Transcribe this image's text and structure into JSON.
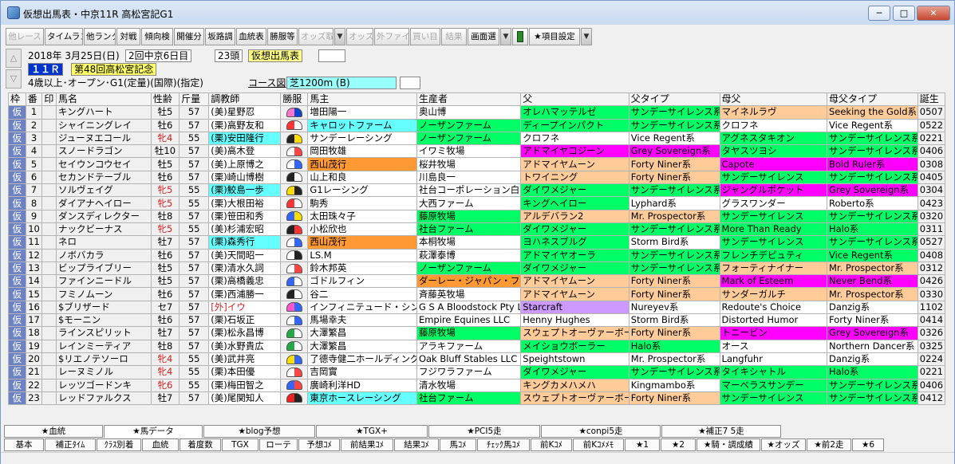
{
  "window": {
    "title": "仮想出馬表・中京11R 高松宮記G1",
    "minimize": "─",
    "maximize": "□",
    "close": "✕",
    "icon": "app-icon"
  },
  "toolbar": [
    {
      "label": "他レース",
      "enabled": false,
      "w": 48
    },
    {
      "label": "タイムランク",
      "enabled": true,
      "w": 48
    },
    {
      "label": "他ランク",
      "enabled": true,
      "w": 40
    },
    {
      "label": "対戦",
      "enabled": true,
      "w": 30
    },
    {
      "label": "傾向検",
      "enabled": true,
      "w": 40
    },
    {
      "label": "開催分",
      "enabled": true,
      "w": 38
    },
    {
      "label": "坂路調",
      "enabled": true,
      "w": 38
    },
    {
      "label": "血統表",
      "enabled": true,
      "w": 38
    },
    {
      "label": "勝服等",
      "enabled": true,
      "w": 38
    },
    {
      "label": "オッズ取",
      "enabled": false,
      "w": 44,
      "dd": true
    },
    {
      "label": "オッズ",
      "enabled": false,
      "w": 34
    },
    {
      "label": "外ファイル",
      "enabled": false,
      "w": 44
    },
    {
      "label": "買い目",
      "enabled": false,
      "w": 38
    },
    {
      "label": "結果",
      "enabled": false,
      "w": 32
    },
    {
      "label": "画面選",
      "enabled": true,
      "w": 40,
      "dd": true
    },
    {
      "label": "",
      "enabled": true,
      "w": 20,
      "icon": "pin-icon"
    },
    {
      "label": "★項目設定",
      "enabled": true,
      "w": 64,
      "dd": true
    }
  ],
  "race": {
    "date": "2018年 3月25日(日)",
    "meeting": "2回中京6日目",
    "entries": "23頭",
    "mode": "仮想出馬表",
    "number": "１１Ｒ",
    "name": "第48回高松宮記念",
    "conditions": "4歳以上･オープン･G1(定量)(国際)(指定)",
    "course_label": "コース図",
    "course": "芝1200m (B)"
  },
  "columns": [
    "枠",
    "番",
    "印",
    "馬名",
    "性齢",
    "斤量",
    "調教師",
    "勝服",
    "馬主",
    "生産者",
    "父",
    "父タイプ",
    "母父",
    "母父タイプ",
    "誕生"
  ],
  "colors": {
    "green": "#00ff66",
    "cyan": "#66ffff",
    "tan": "#ffcc99",
    "magenta": "#ff00ff",
    "orange": "#ff9933",
    "purple": "#cc99ff",
    "plain": "#ffffff"
  },
  "rows": [
    {
      "waku": "仮",
      "ban": "1",
      "name": "キングハート",
      "sex": "牡5",
      "kin": "57",
      "trainer": "(美)星野忍",
      "owner": "増田陽一",
      "breeder": "奥山博",
      "sire": "オレハマッテルゼ",
      "sire_type": "サンデーサイレンス系",
      "dam_sire": "マイネルラヴ",
      "dam_sire_type": "Seeking the Gold系",
      "birth": "0507",
      "cl": {
        "trainer": "plain",
        "owner": "plain",
        "breeder": "plain",
        "sire": "green",
        "sire_type": "green",
        "dam_sire": "tan",
        "dam_sire_type": "tan"
      },
      "silk": [
        "#ff77cc",
        "#1144cc"
      ]
    },
    {
      "waku": "仮",
      "ban": "2",
      "name": "シャイニングレイ",
      "sex": "牡6",
      "kin": "57",
      "trainer": "(栗)高野友和",
      "owner": "キャロットファーム",
      "breeder": "ノーザンファーム",
      "sire": "ディープインパクト",
      "sire_type": "サンデーサイレンス系",
      "dam_sire": "クロフネ",
      "dam_sire_type": "Vice Regent系",
      "birth": "0522",
      "cl": {
        "trainer": "plain",
        "owner": "cyan",
        "breeder": "green",
        "sire": "green",
        "sire_type": "green",
        "dam_sire": "plain",
        "dam_sire_type": "plain"
      },
      "silk": [
        "#ff3333",
        "#ffffff"
      ]
    },
    {
      "waku": "仮",
      "ban": "3",
      "name": "ジューヌエコール",
      "sex": "牝4",
      "kin": "55",
      "trainer": "(栗)安田隆行",
      "owner": "サンデーレーシング",
      "breeder": "ノーザンファーム",
      "sire": "クロフネ",
      "sire_type": "Vice Regent系",
      "dam_sire": "アグネスタキオン",
      "dam_sire_type": "サンデーサイレンス系",
      "birth": "0221",
      "cl": {
        "trainer": "cyan",
        "owner": "plain",
        "breeder": "green",
        "sire": "plain",
        "sire_type": "plain",
        "dam_sire": "green",
        "dam_sire_type": "green"
      },
      "silk": [
        "#222222",
        "#ffdd00"
      ]
    },
    {
      "waku": "仮",
      "ban": "4",
      "name": "スノードラゴン",
      "sex": "牡10",
      "kin": "57",
      "trainer": "(美)高木登",
      "owner": "岡田牧雄",
      "breeder": "イワミ牧場",
      "sire": "アドマイヤコジーン",
      "sire_type": "Grey Sovereign系",
      "dam_sire": "タヤスツヨシ",
      "dam_sire_type": "サンデーサイレンス系",
      "birth": "0406",
      "cl": {
        "trainer": "plain",
        "owner": "plain",
        "breeder": "plain",
        "sire": "magenta",
        "sire_type": "magenta",
        "dam_sire": "green",
        "dam_sire_type": "green"
      },
      "silk": [
        "#ffffff",
        "#ff4444"
      ]
    },
    {
      "waku": "仮",
      "ban": "5",
      "name": "セイウンコウセイ",
      "sex": "牡5",
      "kin": "57",
      "trainer": "(美)上原博之",
      "owner": "西山茂行",
      "breeder": "桜井牧場",
      "sire": "アドマイヤムーン",
      "sire_type": "Forty Niner系",
      "dam_sire": "Capote",
      "dam_sire_type": "Bold Ruler系",
      "birth": "0308",
      "cl": {
        "trainer": "plain",
        "owner": "orange",
        "breeder": "plain",
        "sire": "tan",
        "sire_type": "tan",
        "dam_sire": "magenta",
        "dam_sire_type": "magenta"
      },
      "silk": [
        "#ffffff",
        "#3366ff"
      ]
    },
    {
      "waku": "仮",
      "ban": "6",
      "name": "セカンドテーブル",
      "sex": "牡6",
      "kin": "57",
      "trainer": "(栗)崎山博樹",
      "owner": "山上和良",
      "breeder": "川島良一",
      "sire": "トワイニング",
      "sire_type": "Forty Niner系",
      "dam_sire": "サンデーサイレンス",
      "dam_sire_type": "サンデーサイレンス系",
      "birth": "0405",
      "cl": {
        "trainer": "plain",
        "owner": "plain",
        "breeder": "plain",
        "sire": "tan",
        "sire_type": "tan",
        "dam_sire": "green",
        "dam_sire_type": "green"
      },
      "silk": [
        "#222222",
        "#ffffff"
      ]
    },
    {
      "waku": "仮",
      "ban": "7",
      "name": "ソルヴェイグ",
      "sex": "牝5",
      "kin": "55",
      "trainer": "(栗)鮫島一歩",
      "owner": "G1レーシング",
      "breeder": "社台コーポレーション白老ファーム",
      "sire": "ダイワメジャー",
      "sire_type": "サンデーサイレンス系",
      "dam_sire": "ジャングルポケット",
      "dam_sire_type": "Grey Sovereign系",
      "birth": "0304",
      "cl": {
        "trainer": "cyan",
        "owner": "plain",
        "breeder": "plain",
        "sire": "green",
        "sire_type": "green",
        "dam_sire": "magenta",
        "dam_sire_type": "magenta"
      },
      "silk": [
        "#ffdd00",
        "#222222"
      ]
    },
    {
      "waku": "仮",
      "ban": "8",
      "name": "ダイアナヘイロー",
      "sex": "牝5",
      "kin": "55",
      "trainer": "(栗)大根田裕",
      "owner": "駒秀",
      "breeder": "大西ファーム",
      "sire": "キングヘイロー",
      "sire_type": "Lyphard系",
      "dam_sire": "グラスワンダー",
      "dam_sire_type": "Roberto系",
      "birth": "0423",
      "cl": {
        "trainer": "plain",
        "owner": "plain",
        "breeder": "plain",
        "sire": "green",
        "sire_type": "plain",
        "dam_sire": "plain",
        "dam_sire_type": "plain"
      },
      "silk": [
        "#ff3333",
        "#ffffff"
      ]
    },
    {
      "waku": "仮",
      "ban": "9",
      "name": "ダンスディレクター",
      "sex": "牡8",
      "kin": "57",
      "trainer": "(栗)笹田和秀",
      "owner": "太田珠々子",
      "breeder": "藤原牧場",
      "sire": "アルデバラン2",
      "sire_type": "Mr. Prospector系",
      "dam_sire": "サンデーサイレンス",
      "dam_sire_type": "サンデーサイレンス系",
      "birth": "0320",
      "cl": {
        "trainer": "plain",
        "owner": "plain",
        "breeder": "green",
        "sire": "tan",
        "sire_type": "tan",
        "dam_sire": "green",
        "dam_sire_type": "green"
      },
      "silk": [
        "#3366ff",
        "#ffdd00"
      ]
    },
    {
      "waku": "仮",
      "ban": "10",
      "name": "ナックビーナス",
      "sex": "牝5",
      "kin": "55",
      "trainer": "(美)杉浦宏昭",
      "owner": "小松欣也",
      "breeder": "社台ファーム",
      "sire": "ダイワメジャー",
      "sire_type": "サンデーサイレンス系",
      "dam_sire": "More Than Ready",
      "dam_sire_type": "Halo系",
      "birth": "0311",
      "cl": {
        "trainer": "plain",
        "owner": "plain",
        "breeder": "green",
        "sire": "green",
        "sire_type": "green",
        "dam_sire": "green",
        "dam_sire_type": "green"
      },
      "silk": [
        "#222222",
        "#ff3333"
      ]
    },
    {
      "waku": "仮",
      "ban": "11",
      "name": "ネロ",
      "sex": "牡7",
      "kin": "57",
      "trainer": "(栗)森秀行",
      "owner": "西山茂行",
      "breeder": "本桐牧場",
      "sire": "ヨハネスブルグ",
      "sire_type": "Storm Bird系",
      "dam_sire": "サンデーサイレンス",
      "dam_sire_type": "サンデーサイレンス系",
      "birth": "0527",
      "cl": {
        "trainer": "cyan",
        "owner": "orange",
        "breeder": "plain",
        "sire": "green",
        "sire_type": "plain",
        "dam_sire": "green",
        "dam_sire_type": "green"
      },
      "silk": [
        "#ffffff",
        "#3366ff"
      ]
    },
    {
      "waku": "仮",
      "ban": "12",
      "name": "ノボバカラ",
      "sex": "牡6",
      "kin": "57",
      "trainer": "(美)天間昭一",
      "owner": "LS.M",
      "breeder": "萩澤泰博",
      "sire": "アドマイヤオーラ",
      "sire_type": "サンデーサイレンス系",
      "dam_sire": "フレンチデピュティ",
      "dam_sire_type": "Vice Regent系",
      "birth": "0408",
      "cl": {
        "trainer": "plain",
        "owner": "plain",
        "breeder": "plain",
        "sire": "green",
        "sire_type": "green",
        "dam_sire": "green",
        "dam_sire_type": "green"
      },
      "silk": [
        "#ffffff",
        "#222222"
      ]
    },
    {
      "waku": "仮",
      "ban": "13",
      "name": "ビップライブリー",
      "sex": "牡5",
      "kin": "57",
      "trainer": "(栗)清水久詞",
      "owner": "鈴木邦英",
      "breeder": "ノーザンファーム",
      "sire": "ダイワメジャー",
      "sire_type": "サンデーサイレンス系",
      "dam_sire": "フォーティナイナー",
      "dam_sire_type": "Mr. Prospector系",
      "birth": "0312",
      "cl": {
        "trainer": "plain",
        "owner": "plain",
        "breeder": "green",
        "sire": "green",
        "sire_type": "green",
        "dam_sire": "tan",
        "dam_sire_type": "tan"
      },
      "silk": [
        "#ffffff",
        "#ff4444"
      ]
    },
    {
      "waku": "仮",
      "ban": "14",
      "name": "ファインニードル",
      "sex": "牡5",
      "kin": "57",
      "trainer": "(栗)高橋義忠",
      "owner": "ゴドルフィン",
      "breeder": "ダーレー・ジャパン・ファーム",
      "sire": "アドマイヤムーン",
      "sire_type": "Forty Niner系",
      "dam_sire": "Mark of Esteem",
      "dam_sire_type": "Never Bend系",
      "birth": "0426",
      "cl": {
        "trainer": "plain",
        "owner": "plain",
        "breeder": "orange",
        "sire": "tan",
        "sire_type": "tan",
        "dam_sire": "magenta",
        "dam_sire_type": "magenta"
      },
      "silk": [
        "#3366ff",
        "#ffffff"
      ]
    },
    {
      "waku": "仮",
      "ban": "15",
      "name": "フミノムーン",
      "sex": "牡6",
      "kin": "57",
      "trainer": "(栗)西浦勝一",
      "owner": "谷二",
      "breeder": "斉藤英牧場",
      "sire": "アドマイヤムーン",
      "sire_type": "Forty Niner系",
      "dam_sire": "サンダーガルチ",
      "dam_sire_type": "Mr. Prospector系",
      "birth": "0330",
      "cl": {
        "trainer": "plain",
        "owner": "plain",
        "breeder": "plain",
        "sire": "tan",
        "sire_type": "tan",
        "dam_sire": "tan",
        "dam_sire_type": "tan"
      },
      "silk": [
        "#222222",
        "#ffffff"
      ]
    },
    {
      "waku": "仮",
      "ban": "16",
      "name": "$ブリザード",
      "sex": "セ7",
      "kin": "57",
      "trainer": "[外]イウ",
      "owner": "インフィニテュード・シンジケート",
      "breeder": "G S A Bloodstock Pty Ltd",
      "sire": "Starcraft",
      "sire_type": "Nureyev系",
      "dam_sire": "Redoute's Choice",
      "dam_sire_type": "Danzig系",
      "birth": "1102",
      "cl": {
        "trainer": "plain",
        "owner": "plain",
        "breeder": "plain",
        "sire": "purple",
        "sire_type": "plain",
        "dam_sire": "plain",
        "dam_sire_type": "plain"
      },
      "silk": [
        "#ff55cc",
        "#3366ff"
      ],
      "red_trainer": true
    },
    {
      "waku": "仮",
      "ban": "17",
      "name": "$モーニン",
      "sex": "牡6",
      "kin": "57",
      "trainer": "(栗)石坂正",
      "owner": "馬場幸夫",
      "breeder": "Empire Equines LLC",
      "sire": "Henny Hughes",
      "sire_type": "Storm Bird系",
      "dam_sire": "Distorted Humor",
      "dam_sire_type": "Forty Niner系",
      "birth": "0414",
      "cl": {
        "trainer": "plain",
        "owner": "plain",
        "breeder": "plain",
        "sire": "plain",
        "sire_type": "plain",
        "dam_sire": "plain",
        "dam_sire_type": "plain"
      },
      "silk": [
        "#ffffff",
        "#3366ff"
      ]
    },
    {
      "waku": "仮",
      "ban": "18",
      "name": "ラインスピリット",
      "sex": "牡7",
      "kin": "57",
      "trainer": "(栗)松永昌博",
      "owner": "大澤繁昌",
      "breeder": "藤原牧場",
      "sire": "スウェプトオーヴァーボード",
      "sire_type": "Forty Niner系",
      "dam_sire": "トニービン",
      "dam_sire_type": "Grey Sovereign系",
      "birth": "0326",
      "cl": {
        "trainer": "plain",
        "owner": "plain",
        "breeder": "green",
        "sire": "tan",
        "sire_type": "tan",
        "dam_sire": "magenta",
        "dam_sire_type": "magenta"
      },
      "silk": [
        "#22aa44",
        "#ffffff"
      ]
    },
    {
      "waku": "仮",
      "ban": "19",
      "name": "レインミーティア",
      "sex": "牡8",
      "kin": "57",
      "trainer": "(美)水野貴広",
      "owner": "大澤繁昌",
      "breeder": "アラキファーム",
      "sire": "メイショウボーラー",
      "sire_type": "Halo系",
      "dam_sire": "オース",
      "dam_sire_type": "Northern Dancer系",
      "birth": "0325",
      "cl": {
        "trainer": "plain",
        "owner": "plain",
        "breeder": "plain",
        "sire": "green",
        "sire_type": "green",
        "dam_sire": "plain",
        "dam_sire_type": "plain"
      },
      "silk": [
        "#22aa44",
        "#ffffff"
      ]
    },
    {
      "waku": "仮",
      "ban": "20",
      "name": "$リエノテソーロ",
      "sex": "牝4",
      "kin": "55",
      "trainer": "(美)武井亮",
      "owner": "了德寺健二ホールディングス",
      "breeder": "Oak Bluff Stables LLC",
      "sire": "Speightstown",
      "sire_type": "Mr. Prospector系",
      "dam_sire": "Langfuhr",
      "dam_sire_type": "Danzig系",
      "birth": "0224",
      "cl": {
        "trainer": "plain",
        "owner": "plain",
        "breeder": "plain",
        "sire": "plain",
        "sire_type": "plain",
        "dam_sire": "plain",
        "dam_sire_type": "plain"
      },
      "silk": [
        "#ffdd00",
        "#3366ff"
      ]
    },
    {
      "waku": "仮",
      "ban": "21",
      "name": "レーヌミノル",
      "sex": "牝4",
      "kin": "55",
      "trainer": "(栗)本田優",
      "owner": "吉岡實",
      "breeder": "フジワラファーム",
      "sire": "ダイワメジャー",
      "sire_type": "サンデーサイレンス系",
      "dam_sire": "タイキシャトル",
      "dam_sire_type": "Halo系",
      "birth": "0221",
      "cl": {
        "trainer": "plain",
        "owner": "plain",
        "breeder": "plain",
        "sire": "green",
        "sire_type": "green",
        "dam_sire": "green",
        "dam_sire_type": "green"
      },
      "silk": [
        "#ffffff",
        "#ff4444"
      ]
    },
    {
      "waku": "仮",
      "ban": "22",
      "name": "レッツゴードンキ",
      "sex": "牝6",
      "kin": "55",
      "trainer": "(栗)梅田智之",
      "owner": "廣崎利洋HD",
      "breeder": "清水牧場",
      "sire": "キングカメハメハ",
      "sire_type": "Kingmambo系",
      "dam_sire": "マーベラスサンデー",
      "dam_sire_type": "サンデーサイレンス系",
      "birth": "0406",
      "cl": {
        "trainer": "plain",
        "owner": "plain",
        "breeder": "plain",
        "sire": "tan",
        "sire_type": "plain",
        "dam_sire": "green",
        "dam_sire_type": "green"
      },
      "silk": [
        "#3366ff",
        "#ff4444"
      ]
    },
    {
      "waku": "仮",
      "ban": "23",
      "name": "レッドファルクス",
      "sex": "牡7",
      "kin": "57",
      "trainer": "(美)尾関知人",
      "owner": "東京ホースレーシング",
      "breeder": "社台ファーム",
      "sire": "スウェプトオーヴァーボード",
      "sire_type": "Forty Niner系",
      "dam_sire": "サンデーサイレンス",
      "dam_sire_type": "サンデーサイレンス系",
      "birth": "0412",
      "cl": {
        "trainer": "plain",
        "owner": "cyan",
        "breeder": "green",
        "sire": "tan",
        "sire_type": "tan",
        "dam_sire": "green",
        "dam_sire_type": "green"
      },
      "silk": [
        "#ee2222",
        "#222222"
      ]
    }
  ],
  "tabs_top": [
    {
      "label": "★血統",
      "w": 124
    },
    {
      "label": "★馬データ",
      "w": 124,
      "selected": true
    },
    {
      "label": "★blog予想",
      "w": 140
    },
    {
      "label": "★TGX+",
      "w": 140
    },
    {
      "label": "★PCI5走",
      "w": 140
    },
    {
      "label": "★conpi5走",
      "w": 150
    },
    {
      "label": "★補正7 5走",
      "w": 150
    }
  ],
  "tabs_bottom": [
    {
      "label": "基本",
      "w": 50
    },
    {
      "label": "補正ﾀｲﾑ",
      "w": 64
    },
    {
      "label": "ｸﾗｽ別着",
      "w": 56
    },
    {
      "label": "血統",
      "w": 46
    },
    {
      "label": "着度数",
      "w": 52
    },
    {
      "label": "TGX",
      "w": 46
    },
    {
      "label": "ローテ",
      "w": 48
    },
    {
      "label": "予想ｺﾒ",
      "w": 52
    },
    {
      "label": "前結果ｺﾒ",
      "w": 66
    },
    {
      "label": "結果ｺﾒ",
      "w": 56
    },
    {
      "label": "馬ｺﾒ",
      "w": 46
    },
    {
      "label": "ﾁｪｯｸ馬ｺﾒ",
      "w": 66
    },
    {
      "label": "前Kｺﾒ",
      "w": 52
    },
    {
      "label": "前Kｺﾒﾒﾓ",
      "w": 64
    },
    {
      "label": "★1",
      "w": 44
    },
    {
      "label": "★2",
      "w": 44
    },
    {
      "label": "★騎・調成績",
      "w": 80
    },
    {
      "label": "★オッズ",
      "w": 56
    },
    {
      "label": "★前2走",
      "w": 56
    },
    {
      "label": "★6",
      "w": 40
    }
  ]
}
